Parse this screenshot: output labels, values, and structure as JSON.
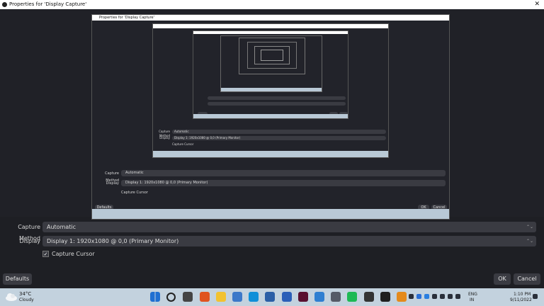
{
  "window": {
    "title": "Properties for 'Display Capture'",
    "close_glyph": "✕"
  },
  "form": {
    "capture_method_label": "Capture Method",
    "capture_method_value": "Automatic",
    "display_label": "Display",
    "display_value": "Display 1: 1920x1080 @ 0,0 (Primary Monitor)",
    "capture_cursor_label": "Capture Cursor",
    "capture_cursor_checked": true,
    "check_glyph": "✓",
    "spinner_glyph": "⌃⌄"
  },
  "buttons": {
    "defaults": "Defaults",
    "ok": "OK",
    "cancel": "Cancel"
  },
  "taskbar": {
    "weather_temp": "34°C",
    "weather_desc": "Cloudy",
    "lang_line1": "ENG",
    "lang_line2": "IN",
    "time": "1:10 PM",
    "date": "9/11/2022",
    "icons": [
      "windows-start-icon",
      "search-icon",
      "task-view-icon",
      "brave-browser-icon",
      "file-explorer-icon",
      "notepad-icon",
      "l-app-icon",
      "photos-icon",
      "word-icon",
      "adobe-app-icon",
      "n-app-icon",
      "settings-icon",
      "spotify-icon",
      "terminal-icon",
      "obs-icon",
      "vlc-icon"
    ],
    "icon_colors": [
      "#1f6fd1",
      "#222222",
      "#444444",
      "#e0531f",
      "#f2c230",
      "#3b78c9",
      "#0f8fd8",
      "#2b5fa6",
      "#2b5fb8",
      "#5a1030",
      "#2f7fd1",
      "#555a66",
      "#1db954",
      "#333333",
      "#1f1f1f",
      "#e48a1b"
    ],
    "tray_icons": [
      "chevron-up-icon",
      "bluetooth-icon",
      "dropbox-icon",
      "app-tray-icon",
      "wifi-icon",
      "volume-icon",
      "battery-icon",
      "notification-icon"
    ]
  }
}
